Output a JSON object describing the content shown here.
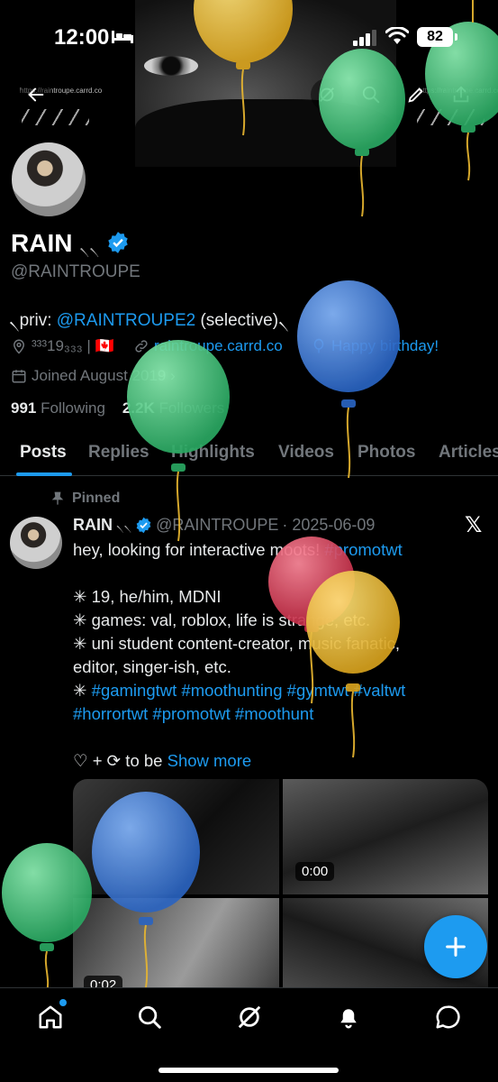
{
  "status_bar": {
    "time": "12:00",
    "battery": "82"
  },
  "banner": {
    "url_left": "https://raintroupe.carrd.co",
    "url_right": "https://raintroupe.carrd.co"
  },
  "profile": {
    "name": "RAIN",
    "name_suffix": "৲৲",
    "handle": "@RAINTROUPE",
    "bio_prefix": "৲priv: ",
    "bio_link": "@RAINTROUPE2",
    "bio_suffix": " (selective)৲",
    "location": "³³³19₃₃₃ | 🇨🇦",
    "website": "raintroupe.carrd.co",
    "birthday": "Happy birthday!",
    "joined": "Joined August 2019 ›",
    "following_count": "991",
    "following_label": "Following",
    "followers_count": "2.2K",
    "followers_label": "Followers"
  },
  "tabs": [
    "Posts",
    "Replies",
    "Highlights",
    "Videos",
    "Photos",
    "Articles"
  ],
  "post": {
    "pinned_label": "Pinned",
    "author": "RAIN",
    "author_suffix": "৲৲",
    "handle": "@RAINTROUPE",
    "date": "· 2025-06-09",
    "lines": [
      {
        "text": "hey, looking for interactive moots! ",
        "tag": "#promotwt"
      },
      {
        "text": "",
        "tag": ""
      },
      {
        "text": "✳ 19, he/him, MDNI",
        "tag": ""
      },
      {
        "text": "✳ games: val, roblox, life is strange, etc.",
        "tag": ""
      },
      {
        "text": "✳ uni student content-creator, music fanatic,",
        "tag": ""
      },
      {
        "text": "editor, singer-ish, etc.",
        "tag": ""
      },
      {
        "text": "✳ ",
        "tag": "#gamingtwt #moothunting #gymtwt #valtwt"
      },
      {
        "text": "",
        "tag": "#horrortwt #promotwt  #moothunt"
      },
      {
        "text": "",
        "tag": ""
      }
    ],
    "footer_text": "♡ + ⟳ to be ",
    "show_more": "Show more",
    "media_durations": [
      "0:00",
      "0:02"
    ]
  },
  "icons": {
    "back": "back-arrow-icon",
    "grok": "grok-icon",
    "search": "search-icon",
    "edit": "edit-icon",
    "share": "share-icon",
    "verified": "verified-badge-icon",
    "location": "location-pin-icon",
    "link": "link-icon",
    "balloon": "balloon-icon",
    "calendar": "calendar-icon",
    "pin": "pin-icon",
    "compose": "plus-icon",
    "nav": [
      "home-icon",
      "search-icon",
      "grok-icon",
      "notifications-icon",
      "messages-icon"
    ]
  },
  "colors": {
    "accent": "#1d9bf0",
    "background": "#000000",
    "text_primary": "#e7e9ea",
    "text_secondary": "#71767b",
    "balloon_yellow": "#e8b630",
    "balloon_green": "#3ec27a",
    "balloon_blue": "#3a7fd5",
    "balloon_red": "#d63a52"
  }
}
